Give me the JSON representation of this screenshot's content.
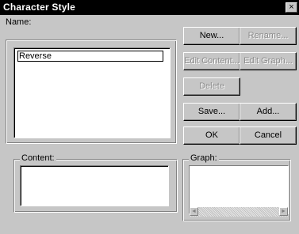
{
  "window": {
    "title": "Character Style",
    "close_glyph": "×"
  },
  "name_section": {
    "label": "Name:",
    "items": [
      "Reverse"
    ]
  },
  "buttons": {
    "new": "New...",
    "rename": "Rename...",
    "edit_content": "Edit Content...",
    "edit_graph": "Edit Graph...",
    "delete": "Delete",
    "save": "Save...",
    "add": "Add...",
    "ok": "OK",
    "cancel": "Cancel"
  },
  "content_section": {
    "label": "Content:"
  },
  "graph_section": {
    "label": "Graph:"
  },
  "scrollbar": {
    "left_arrow": "◄",
    "right_arrow": "►"
  }
}
